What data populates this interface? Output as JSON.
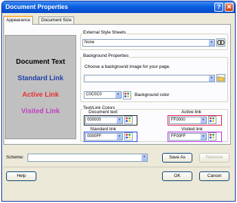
{
  "window": {
    "title": "Document Properties",
    "help_glyph": "?",
    "close_glyph": "✕"
  },
  "tabs": [
    {
      "label": "Appearance"
    },
    {
      "label": "Document Size"
    }
  ],
  "preview": {
    "background": "#c0c0c0",
    "document_text": "Document Text",
    "standard_link": "Standard Link",
    "active_link": "Active Link",
    "visited_link": "Visited Link",
    "colors": {
      "document_text": "#000000",
      "standard_link": "#0000ff",
      "active_link": "#ff0000",
      "visited_link": "#ff00ff"
    }
  },
  "external_style_sheets": {
    "label": "External Style Sheets",
    "value": "None"
  },
  "background_properties": {
    "label": "Background Properties",
    "image_prompt": "Choose a background image for your page.",
    "image_value": "",
    "color_value": "C0C0C0",
    "color_label": "Background color"
  },
  "text_link_colors": {
    "label": "Text/Link Colors",
    "document_text": {
      "label": "Document text",
      "value": "000000",
      "accent": "#1a1a1a"
    },
    "active_link": {
      "label": "Active link",
      "value": "FF0000",
      "accent": "#e0103a"
    },
    "standard_link": {
      "label": "Standard link",
      "value": "0000FF",
      "accent": "#1a3fd0"
    },
    "visited_link": {
      "label": "Visited link",
      "value": "FF00FF",
      "accent": "#b326d6"
    }
  },
  "scheme": {
    "label": "Scheme:",
    "value": "",
    "save_as": "Save As",
    "remove": "Remove"
  },
  "footer": {
    "help": "Help",
    "ok": "OK",
    "cancel": "Cancel"
  },
  "icons": {
    "dropdown": "▼",
    "browse": "folder-open-icon",
    "link_stylesheet": "chain-link-icon",
    "palette": "color-palette-icon"
  }
}
